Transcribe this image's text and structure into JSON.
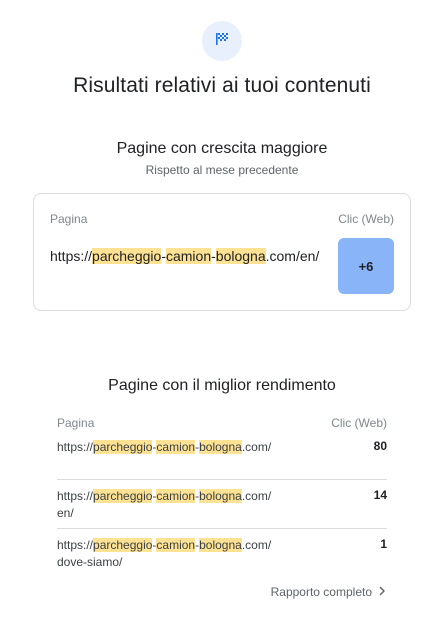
{
  "header": {
    "icon": "flag-icon",
    "title": "Risultati relativi ai tuoi contenuti"
  },
  "growth": {
    "title": "Pagine con crescita maggiore",
    "subtitle": "Rispetto al mese precedente",
    "col_page": "Pagina",
    "col_clicks": "Clic (Web)",
    "row": {
      "url_prefix": "https://",
      "kw1": "parcheggio",
      "sep1": "-",
      "kw2": "camion",
      "sep2": "-",
      "kw3": "bologna",
      "url_suffix": ".com/en/",
      "delta": "+6"
    },
    "accent": "#8ab4f8"
  },
  "top": {
    "title": "Pagine con il miglior rendimento",
    "col_page": "Pagina",
    "col_clicks": "Clic (Web)",
    "rows": [
      {
        "url_prefix": "https://",
        "kw1": "parcheggio",
        "sep1": "-",
        "kw2": "camion",
        "sep2": "-",
        "kw3": "bologna",
        "url_suffix": ".com/",
        "clicks": "80"
      },
      {
        "url_prefix": "https://",
        "kw1": "parcheggio",
        "sep1": "-",
        "kw2": "camion",
        "sep2": "-",
        "kw3": "bologna",
        "url_suffix": ".com/en/",
        "clicks": "14"
      },
      {
        "url_prefix": "https://",
        "kw1": "parcheggio",
        "sep1": "-",
        "kw2": "camion",
        "sep2": "-",
        "kw3": "bologna",
        "url_suffix": ".com/dove-siamo/",
        "clicks": "1"
      }
    ]
  },
  "footer": {
    "report_label": "Rapporto completo",
    "report_icon": "chevron-right-icon"
  },
  "highlight_color": "#fde293"
}
